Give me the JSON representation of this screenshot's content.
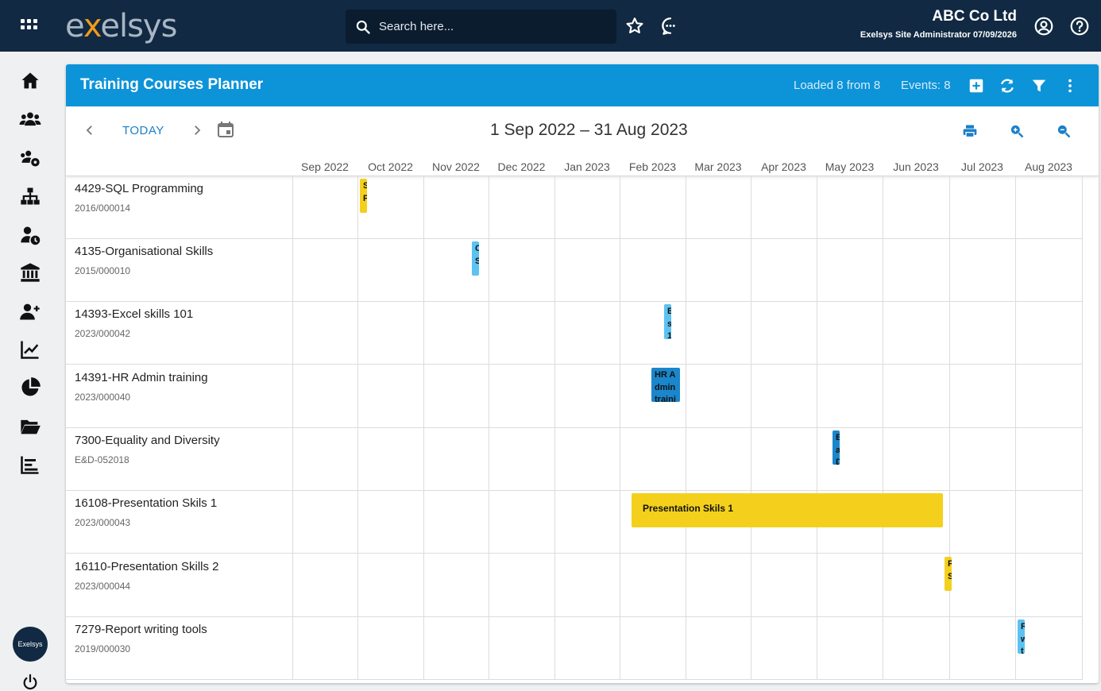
{
  "header": {
    "logo_prefix": "e",
    "logo_x": "x",
    "logo_suffix": "elsys",
    "search_placeholder": "Search here...",
    "company": "ABC Co Ltd",
    "user_line": "Exelsys Site Administrator 07/09/2026"
  },
  "sidebar": {
    "items": [
      {
        "name": "home-icon"
      },
      {
        "name": "people-icon"
      },
      {
        "name": "people-settings-icon"
      },
      {
        "name": "org-chart-icon"
      },
      {
        "name": "person-clock-icon"
      },
      {
        "name": "bank-icon"
      },
      {
        "name": "person-add-icon"
      },
      {
        "name": "line-chart-icon"
      },
      {
        "name": "pie-chart-icon"
      },
      {
        "name": "folder-open-icon"
      },
      {
        "name": "bar-chart-icon"
      }
    ],
    "brand": "Exelsys"
  },
  "panel": {
    "title": "Training Courses Planner",
    "loaded": "Loaded 8 from 8",
    "events": "Events: 8"
  },
  "toolbar": {
    "today": "TODAY",
    "range": "1 Sep 2022 – 31 Aug 2023"
  },
  "months": [
    "Sep 2022",
    "Oct 2022",
    "Nov 2022",
    "Dec 2022",
    "Jan 2023",
    "Feb 2023",
    "Mar 2023",
    "Apr 2023",
    "May 2023",
    "Jun 2023",
    "Jul 2023",
    "Aug 2023"
  ],
  "courses": [
    {
      "name": "4429-SQL Programming",
      "code": "2016/000014"
    },
    {
      "name": "4135-Organisational Skills",
      "code": "2015/000010"
    },
    {
      "name": "14393-Excel skills 101",
      "code": "2023/000042"
    },
    {
      "name": "14391-HR Admin training",
      "code": "2023/000040"
    },
    {
      "name": "7300-Equality and Diversity",
      "code": "E&D-052018"
    },
    {
      "name": "16108-Presentation Skils 1",
      "code": "2023/000043"
    },
    {
      "name": "16110-Presentation Skills 2",
      "code": "2023/000044"
    },
    {
      "name": "7279-Report writing tools",
      "code": "2019/000030"
    }
  ],
  "event_labels": {
    "e1": "S P",
    "e2": "O S",
    "e3": "E s 1",
    "e4": "HR Admin training",
    "e5": "E a D",
    "e6": "Presentation Skils 1",
    "e7": "P S",
    "e8": "R w t"
  },
  "colors": {
    "topbar": "#112942",
    "header_blue": "#0d93d8",
    "event_yellow": "#f4d01c",
    "event_light_blue": "#5cc2f2",
    "event_blue": "#1a86cc"
  }
}
